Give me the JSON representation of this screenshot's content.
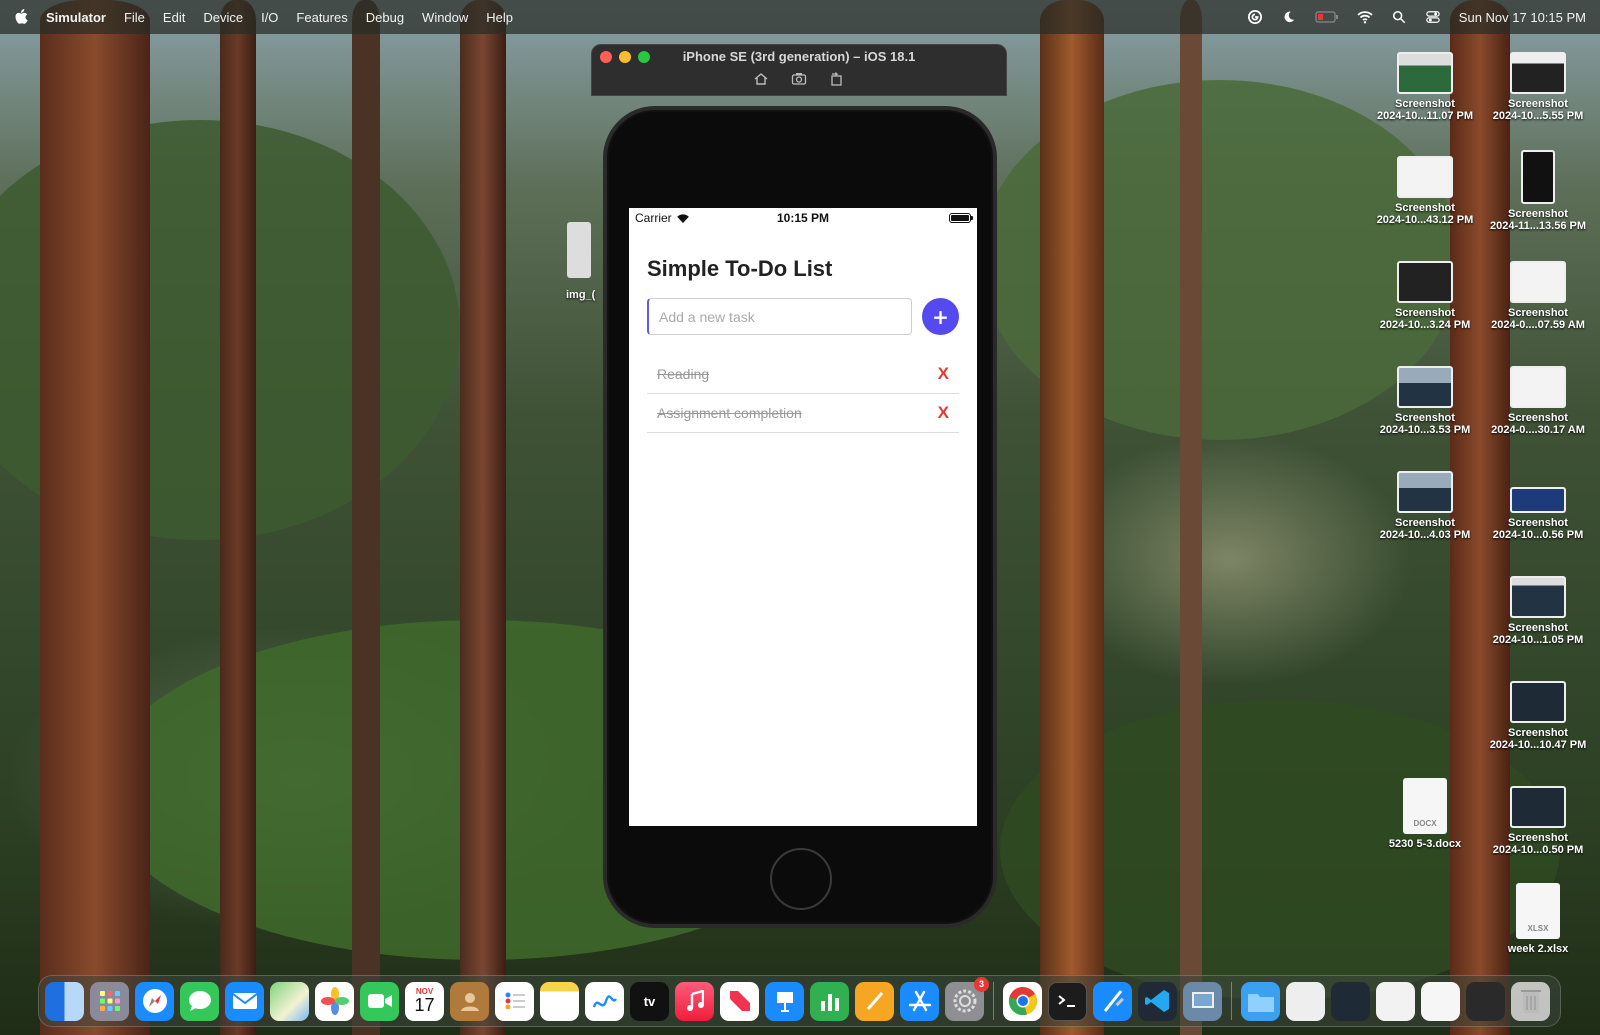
{
  "menubar": {
    "app_name": "Simulator",
    "items": [
      "File",
      "Edit",
      "Device",
      "I/O",
      "Features",
      "Debug",
      "Window",
      "Help"
    ],
    "datetime": "Sun Nov 17  10:15 PM"
  },
  "simulator": {
    "title": "iPhone SE (3rd generation) – iOS 18.1",
    "tools": [
      "home-icon",
      "screenshot-icon",
      "rotate-icon"
    ]
  },
  "phone_status": {
    "carrier": "Carrier",
    "time": "10:15 PM"
  },
  "app": {
    "title": "Simple To-Do List",
    "input_placeholder": "Add a new task",
    "add_label": "+",
    "tasks": [
      {
        "text": "Reading",
        "completed": true,
        "delete_label": "X"
      },
      {
        "text": "Assignment completion",
        "completed": true,
        "delete_label": "X"
      }
    ]
  },
  "desktop": {
    "partial_label": "img_(",
    "files": [
      {
        "line1": "Screenshot",
        "line2": "2024-10...11.07 PM"
      },
      {
        "line1": "Screenshot",
        "line2": "2024-10...5.55 PM"
      },
      {
        "line1": "Screenshot",
        "line2": "2024-10...43.12 PM"
      },
      {
        "line1": "Screenshot",
        "line2": "2024-11...13.56 PM"
      },
      {
        "line1": "Screenshot",
        "line2": "2024-10...3.24 PM"
      },
      {
        "line1": "Screenshot",
        "line2": "2024-0....07.59 AM"
      },
      {
        "line1": "Screenshot",
        "line2": "2024-10...3.53 PM"
      },
      {
        "line1": "Screenshot",
        "line2": "2024-0....30.17 AM"
      },
      {
        "line1": "Screenshot",
        "line2": "2024-10...4.03 PM"
      },
      {
        "line1": "Screenshot",
        "line2": "2024-10...0.56 PM"
      },
      {
        "line1": "Screenshot",
        "line2": "2024-10...1.05 PM"
      },
      {
        "line1": "Screenshot",
        "line2": "2024-10...10.47 PM"
      },
      {
        "line1": "5230 5-3.docx",
        "line2": ""
      },
      {
        "line1": "Screenshot",
        "line2": "2024-10...0.50 PM"
      },
      {
        "line1": "week 2.xlsx",
        "line2": ""
      }
    ],
    "docx_label": "DOCX",
    "xlsx_label": "XLSX"
  },
  "dock": {
    "calendar_month": "NOV",
    "calendar_day": "17",
    "tv_label": "tv",
    "settings_badge": "3"
  },
  "colors": {
    "accent": "#5549f0",
    "delete": "#e53935"
  }
}
